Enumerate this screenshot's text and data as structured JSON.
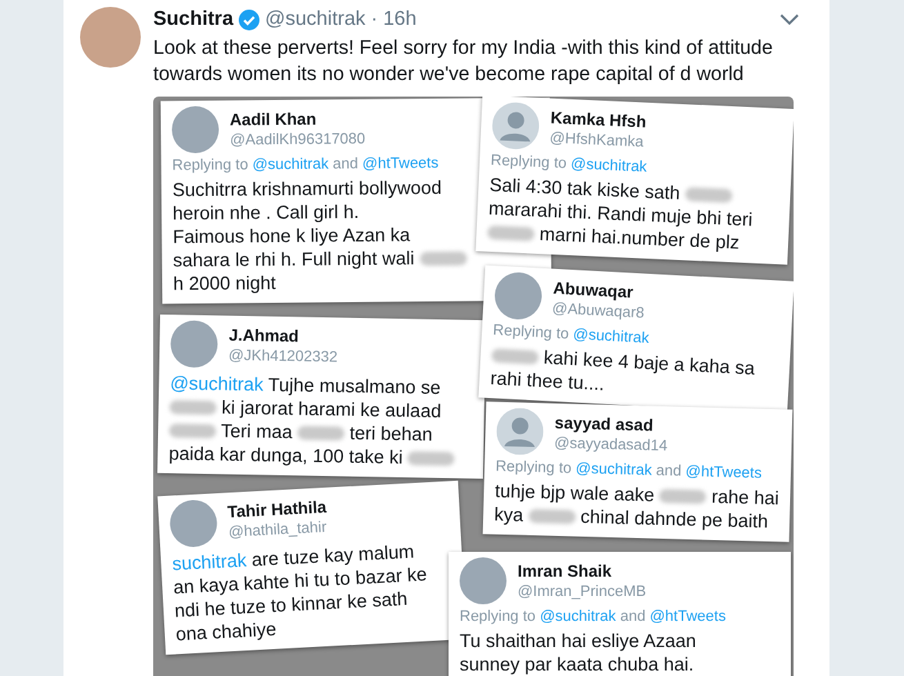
{
  "tweet": {
    "author": {
      "name": "Suchitra",
      "handle": "@suchitrak",
      "verified": true
    },
    "separator": "·",
    "time": "16h",
    "text": "Look at these perverts! Feel sorry for my India -with this kind of attitude towards women its no wonder we've become rape capital of d world",
    "media": {
      "cards": [
        {
          "name": "Aadil Khan",
          "handle": "@AadilKh96317080",
          "kind": "photo",
          "replying": [
            {
              "kind": "text",
              "text": "Replying to "
            },
            {
              "kind": "link",
              "text": "@suchitrak"
            },
            {
              "kind": "text",
              "text": " and "
            },
            {
              "kind": "link",
              "text": "@htTweets"
            }
          ],
          "lines": [
            [
              {
                "kind": "text",
                "text": "Suchitrra krishnamurti bollywood"
              }
            ],
            [
              {
                "kind": "text",
                "text": "heroin nhe . Call girl h."
              }
            ],
            [
              {
                "kind": "text",
                "text": "Faimous hone k liye Azan ka"
              }
            ],
            [
              {
                "kind": "text",
                "text": "sahara le rhi h. Full night wali "
              },
              {
                "kind": "blur"
              }
            ],
            [
              {
                "kind": "text",
                "text": "h 2000 night"
              }
            ]
          ]
        },
        {
          "name": "Kamka Hfsh",
          "handle": "@HfshKamka",
          "kind": "default",
          "replying": [
            {
              "kind": "text",
              "text": "Replying to "
            },
            {
              "kind": "link",
              "text": "@suchitrak"
            }
          ],
          "lines": [
            [
              {
                "kind": "text",
                "text": "Sali 4:30 tak kiske sath "
              },
              {
                "kind": "blur"
              }
            ],
            [
              {
                "kind": "text",
                "text": "mararahi thi. Randi muje bhi teri"
              }
            ],
            [
              {
                "kind": "blur"
              },
              {
                "kind": "text",
                "text": " marni hai.number de plz"
              }
            ]
          ]
        },
        {
          "name": "Abuwaqar",
          "handle": "@Abuwaqar8",
          "kind": "photo",
          "replying": [
            {
              "kind": "text",
              "text": "Replying to "
            },
            {
              "kind": "link",
              "text": "@suchitrak"
            }
          ],
          "lines": [
            [
              {
                "kind": "blur"
              },
              {
                "kind": "text",
                "text": " kahi kee 4 baje a kaha sa"
              }
            ],
            [
              {
                "kind": "text",
                "text": "rahi thee tu...."
              }
            ]
          ]
        },
        {
          "name": "J.Ahmad",
          "handle": "@JKh41202332",
          "kind": "photo",
          "lines": [
            [
              {
                "kind": "link",
                "text": "@suchitrak"
              },
              {
                "kind": "text",
                "text": " Tujhe musalmano se"
              }
            ],
            [
              {
                "kind": "blur"
              },
              {
                "kind": "text",
                "text": " ki jarorat harami ke aulaad"
              }
            ],
            [
              {
                "kind": "blur"
              },
              {
                "kind": "text",
                "text": " Teri maa "
              },
              {
                "kind": "blur"
              },
              {
                "kind": "text",
                "text": " teri behan"
              }
            ],
            [
              {
                "kind": "text",
                "text": "paida kar dunga, 100 take ki "
              },
              {
                "kind": "blur"
              }
            ]
          ]
        },
        {
          "name": "sayyad asad",
          "handle": "@sayyadasad14",
          "kind": "default",
          "replying": [
            {
              "kind": "text",
              "text": "Replying to "
            },
            {
              "kind": "link",
              "text": "@suchitrak"
            },
            {
              "kind": "text",
              "text": " and "
            },
            {
              "kind": "link",
              "text": "@htTweets"
            }
          ],
          "lines": [
            [
              {
                "kind": "text",
                "text": "tuhje bjp wale aake "
              },
              {
                "kind": "blur"
              },
              {
                "kind": "text",
                "text": " rahe hai"
              }
            ],
            [
              {
                "kind": "text",
                "text": "kya "
              },
              {
                "kind": "blur"
              },
              {
                "kind": "text",
                "text": " chinal dahnde pe baith"
              }
            ]
          ]
        },
        {
          "name": "Tahir Hathila",
          "handle": "@hathila_tahir",
          "kind": "photo",
          "lines": [
            [
              {
                "kind": "link",
                "text": "suchitrak"
              },
              {
                "kind": "text",
                "text": "  are tuze kay malum"
              }
            ],
            [
              {
                "kind": "text",
                "text": "an kaya kahte hi tu to bazar ke"
              }
            ],
            [
              {
                "kind": "text",
                "text": "ndi he tuze to kinnar ke sath"
              }
            ],
            [
              {
                "kind": "text",
                "text": "ona chahiye"
              }
            ]
          ]
        },
        {
          "name": "Imran Shaik",
          "handle": "@Imran_PrinceMB",
          "kind": "photo",
          "replying": [
            {
              "kind": "text",
              "text": "Replying to "
            },
            {
              "kind": "link",
              "text": "@suchitrak"
            },
            {
              "kind": "text",
              "text": " and "
            },
            {
              "kind": "link",
              "text": "@htTweets"
            }
          ],
          "lines": [
            [
              {
                "kind": "text",
                "text": "Tu shaithan hai esliye Azaan"
              }
            ],
            [
              {
                "kind": "text",
                "text": "sunney par kaata chuba hai."
              }
            ]
          ]
        }
      ]
    }
  }
}
